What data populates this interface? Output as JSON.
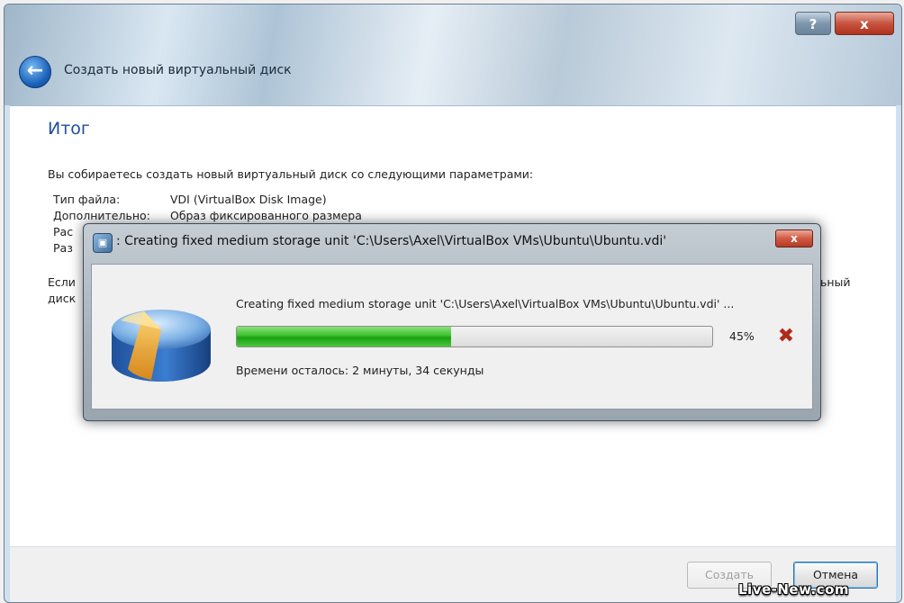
{
  "wizard": {
    "title": "Создать новый виртуальный диск",
    "help_label": "?",
    "close_label": "x",
    "back_icon": "back-arrow-icon",
    "heading": "Итог",
    "intro": "Вы собираетесь создать новый виртуальный диск со следующими параметрами:",
    "params": [
      {
        "label": "Тип файла:",
        "value": "VDI (VirtualBox Disk Image)"
      },
      {
        "label": "Дополнительно:",
        "value": "Образ фиксированного размера"
      },
      {
        "label": "Рас",
        "value": ""
      },
      {
        "label": "Раз",
        "value": ""
      }
    ],
    "cutoff_left_1": "Если",
    "cutoff_left_2": "диск",
    "cutoff_right": "ьный",
    "buttons": {
      "create": "Создать",
      "cancel": "Отмена"
    }
  },
  "progress_dialog": {
    "icon": "virtualbox-icon",
    "title": ": Creating fixed medium storage unit 'C:\\Users\\Axel\\VirtualBox VMs\\Ubuntu\\Ubuntu.vdi'",
    "close_label": "x",
    "operation": "Creating fixed medium storage unit 'C:\\Users\\Axel\\VirtualBox VMs\\Ubuntu\\Ubuntu.vdi' ...",
    "progress_percent": 45,
    "progress_label": "45%",
    "time_remaining": "Времени осталось: 2 минуты, 34 секунды",
    "cancel_icon": "cancel-x-icon"
  },
  "watermark": "Live-New.com"
}
